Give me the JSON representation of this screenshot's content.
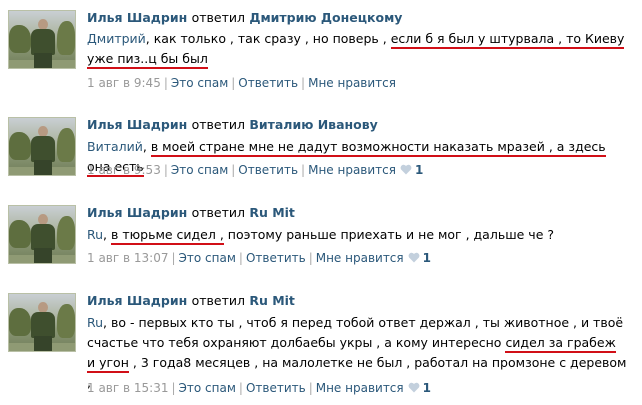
{
  "comments": [
    {
      "author": "Илья Шадрин",
      "verb": "ответил",
      "target": "Дмитрию Донецкому",
      "addressee": "Дмитрий",
      "text_plain": ", как только , так сразу , но поверь ,",
      "text_underlined": "если б я был у штурвала , то Киеву уже пиз..ц бы был",
      "time": "1 авг в 9:45",
      "spam": "Это спам",
      "reply": "Ответить",
      "like": "Мне нравится",
      "likes": ""
    },
    {
      "author": "Илья Шадрин",
      "verb": "ответил",
      "target": "Виталию Иванову",
      "addressee": "Виталий",
      "text_underlined": "в моей стране мне не дадут возможности наказать мразей , а здесь она есть",
      "time": "1 авг в 9:53",
      "spam": "Это спам",
      "reply": "Ответить",
      "like": "Мне нравится",
      "likes": "1"
    },
    {
      "author": "Илья Шадрин",
      "verb": "ответил",
      "target": "Ru Mit",
      "addressee": "Ru",
      "text_underlined": "в тюрьме сидел ,",
      "text_plain": "поэтому раньше приехать и не мог , дальше че ?",
      "time": "1 авг в 13:07",
      "spam": "Это спам",
      "reply": "Ответить",
      "like": "Мне нравится",
      "likes": "1"
    },
    {
      "author": "Илья Шадрин",
      "verb": "ответил",
      "target": "Ru Mit",
      "addressee": "Ru",
      "text_plain1": ", во - первых кто ты , чтоб я перед тобой ответ держал , ты животное , и твоё счастье что тебя охраняют долбаебы укры , а кому интересно",
      "text_underlined": "сидел за грабеж и угон",
      "text_plain2": ", 3 года8 месяцев , на малолетке не был , работал на промзоне с деревом ,",
      "time": "1 авг в 15:31",
      "spam": "Это спам",
      "reply": "Ответить",
      "like": "Мне нравится",
      "likes": "1"
    }
  ],
  "colors": {
    "link": "#2b587a",
    "underline": "#d10f17",
    "muted": "#999999",
    "heart": "#c3d0dd"
  },
  "icons": {
    "like": "heart-icon"
  }
}
